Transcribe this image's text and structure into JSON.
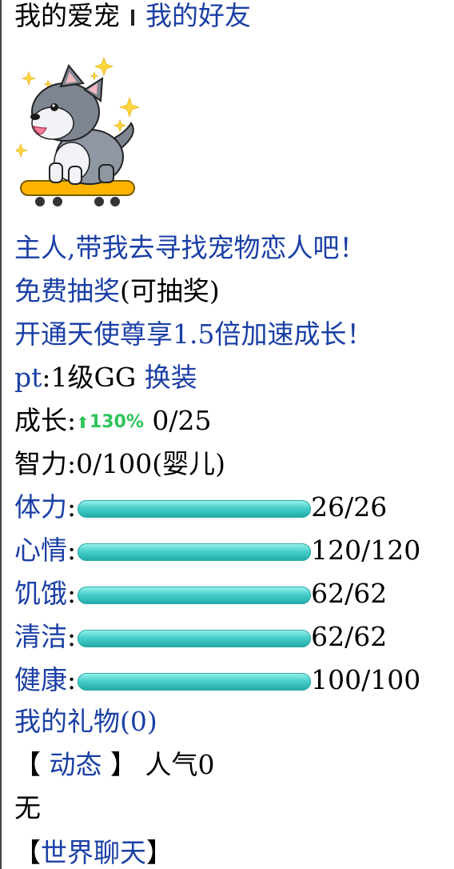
{
  "tabs": {
    "my_pet": "我的爱宠",
    "my_friends": "我的好友"
  },
  "pet_icon": "husky-on-skateboard-icon",
  "links": {
    "find_lover": "主人,带我去寻找宠物恋人吧！",
    "free_lottery": "免费抽奖",
    "free_lottery_status": "(可抽奖)",
    "angel": "开通天使尊享1.5倍加速成长！",
    "pt_prefix": "pt",
    "pt_level": ":1级GG",
    "dress": "换装"
  },
  "growth": {
    "label": "成长:",
    "rate": "130%",
    "value": "0/25"
  },
  "intellect": "智力:0/100(婴儿)",
  "stats": [
    {
      "label": "体力",
      "value": "26/26",
      "fill": 1.0
    },
    {
      "label": "心情",
      "value": "120/120",
      "fill": 1.0
    },
    {
      "label": "饥饿",
      "value": "62/62",
      "fill": 1.0
    },
    {
      "label": "清洁",
      "value": "62/62",
      "fill": 1.0
    },
    {
      "label": "健康",
      "value": "100/100",
      "fill": 1.0
    }
  ],
  "gifts": "我的礼物(0)",
  "dynamics": {
    "open": "【",
    "label": " 动态 ",
    "close": "】",
    "popularity": "人气0"
  },
  "dynamics_content": "无",
  "world_chat": {
    "open": "【",
    "label": "世界聊天",
    "close": "】"
  },
  "colors": {
    "link": "#1a3fa5",
    "bar": "#49cfcb",
    "growth_arrow": "#2ec45a"
  }
}
